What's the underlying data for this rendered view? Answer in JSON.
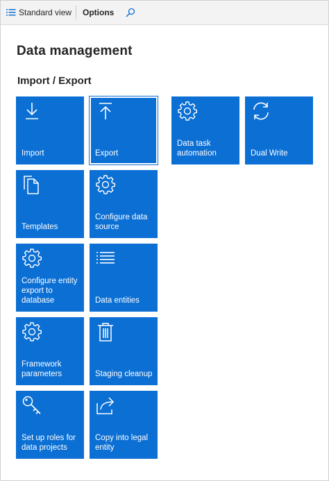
{
  "toolbar": {
    "view_label": "Standard view",
    "options_label": "Options",
    "icons": {
      "view": "list-view-icon",
      "search": "search-icon"
    }
  },
  "page": {
    "title": "Data management",
    "section_title": "Import / Export"
  },
  "tiles": [
    {
      "label": "Import",
      "icon": "download-arrow-icon"
    },
    {
      "label": "Export",
      "icon": "upload-arrow-icon",
      "selected": true
    },
    {
      "label": "Data task automation",
      "icon": "gear-icon"
    },
    {
      "label": "Dual Write",
      "icon": "sync-icon"
    },
    {
      "label": "Templates",
      "icon": "copy-documents-icon"
    },
    {
      "label": "Configure data source",
      "icon": "gear-icon"
    },
    {
      "label": "Configure entity export to database",
      "icon": "gear-icon"
    },
    {
      "label": "Data entities",
      "icon": "list-icon"
    },
    {
      "label": "Framework parameters",
      "icon": "gear-icon"
    },
    {
      "label": "Staging cleanup",
      "icon": "trash-icon"
    },
    {
      "label": "Set up roles for data projects",
      "icon": "key-icon"
    },
    {
      "label": "Copy into legal entity",
      "icon": "share-arrow-icon"
    }
  ],
  "colors": {
    "tile": "#0b6fd4",
    "toolbar": "#f3f3f3",
    "search_icon": "#0b6fd4"
  }
}
